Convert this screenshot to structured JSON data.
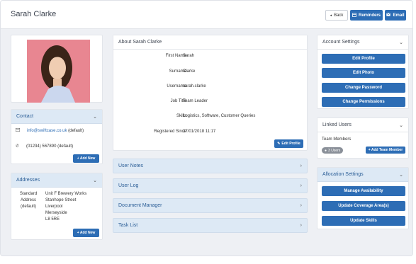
{
  "header": {
    "title": "Sarah Clarke",
    "back_label": "Back",
    "reminders_label": "Reminders",
    "email_label": "Email"
  },
  "contact": {
    "title": "Contact",
    "email": "info@swiftcase.co.uk",
    "email_suffix": "(default)",
    "phone": "(01234) 567890 (default)",
    "add_new": "+ Add New"
  },
  "addresses": {
    "title": "Addresses",
    "label_lines": [
      "Standard",
      "Address",
      "(default)"
    ],
    "address_lines": [
      "Unit F Brewery Works",
      "Stanhope Street",
      "Liverpool",
      "Merseyside",
      "L8 5RE"
    ],
    "add_new": "+ Add New"
  },
  "about": {
    "title": "About Sarah Clarke",
    "rows": [
      {
        "label": "First Name",
        "value": "Sarah"
      },
      {
        "label": "Surname",
        "value": "Clarke"
      },
      {
        "label": "Username",
        "value": "sarah.clarke"
      },
      {
        "label": "Job Title",
        "value": "Team Leader"
      },
      {
        "label": "Skills",
        "value": "Logistics, Software, Customer Queries"
      },
      {
        "label": "Registered Since",
        "value": "27/01/2018 11:17"
      }
    ],
    "edit_profile": "Edit Profile"
  },
  "sections": [
    {
      "label": "User Notes"
    },
    {
      "label": "User Log"
    },
    {
      "label": "Document Manager"
    },
    {
      "label": "Task List"
    }
  ],
  "account_settings": {
    "title": "Account Settings",
    "buttons": [
      "Edit Profile",
      "Edit Photo",
      "Change Password",
      "Change Permissions"
    ]
  },
  "linked_users": {
    "title": "Linked Users",
    "group": "Team Members",
    "badge": "3 Users",
    "add_button": "+ Add Team Member"
  },
  "allocation_settings": {
    "title": "Allocation Settings",
    "buttons": [
      "Manage Availability",
      "Update Coverage Area(s)",
      "Update Skills"
    ]
  },
  "colors": {
    "accent": "#2d6db5",
    "panel_header": "#dde9f5",
    "background": "#eef0f4"
  }
}
